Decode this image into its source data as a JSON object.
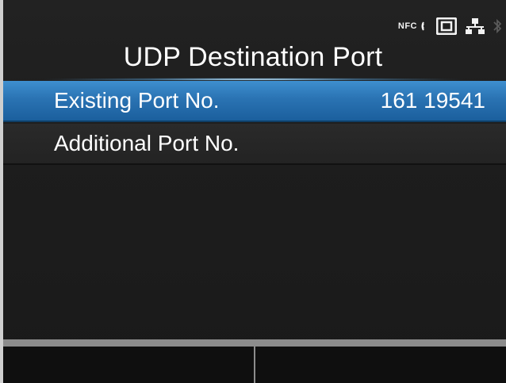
{
  "status_icons": {
    "nfc_label": "NFC",
    "icons": [
      "nfc-icon",
      "sd-card-icon",
      "network-icon",
      "bluetooth-icon"
    ]
  },
  "header": {
    "title": "UDP Destination Port"
  },
  "menu": {
    "items": [
      {
        "label": "Existing Port No.",
        "value": "161 19541",
        "selected": true
      },
      {
        "label": "Additional Port No.",
        "value": "",
        "selected": false
      }
    ]
  },
  "softkeys": {
    "left_label": "",
    "right_label": ""
  },
  "colors": {
    "accent": "#2a73b3",
    "background": "#1d1d1d",
    "softkey_border": "#8c8c8c"
  }
}
